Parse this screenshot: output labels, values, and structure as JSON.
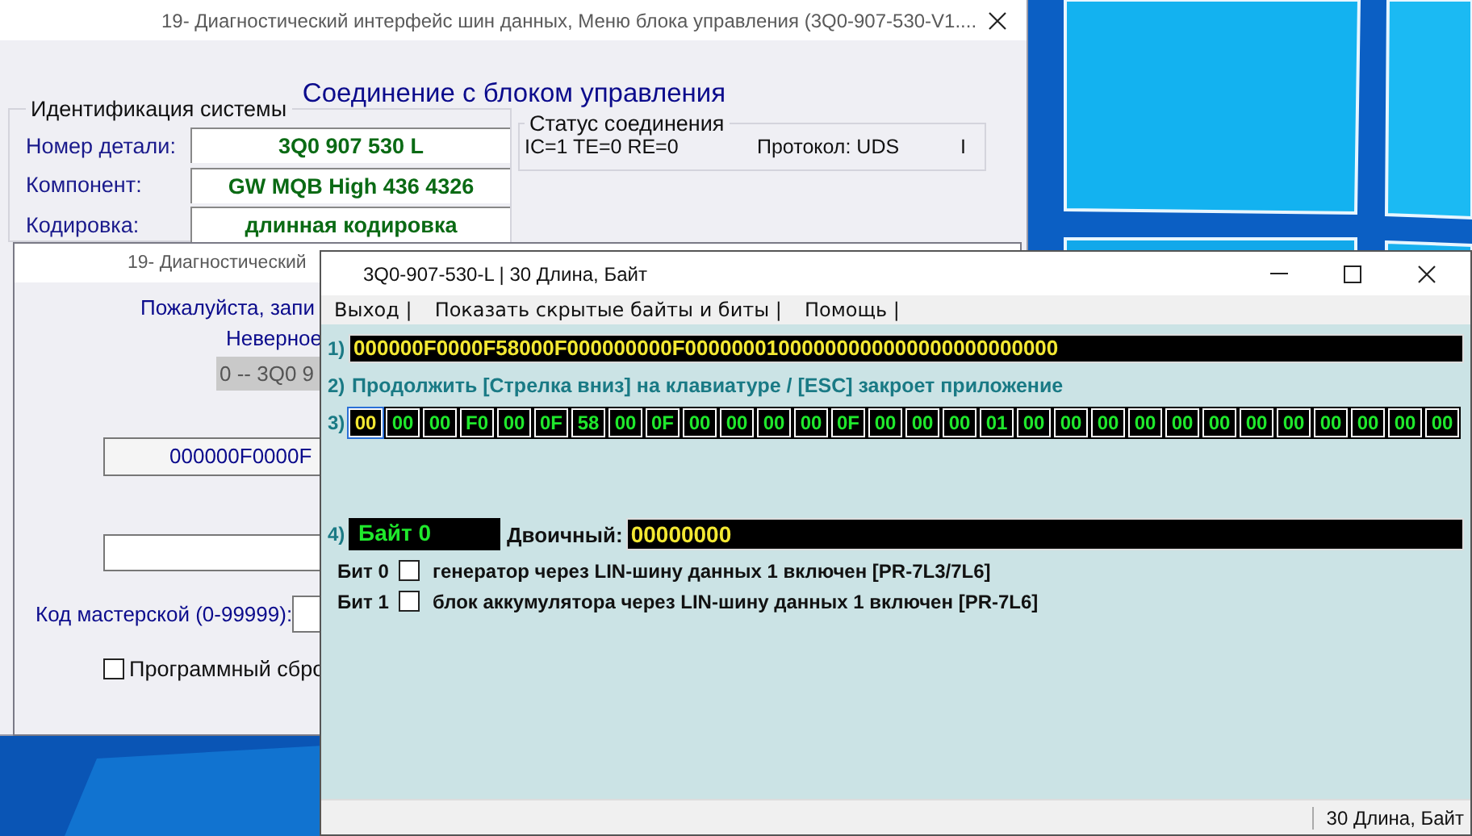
{
  "back_window": {
    "title": "19- Диагностический интерфейс шин данных,  Меню блока управления (3Q0-907-530-V1....",
    "heading": "Соединение с блоком управления",
    "identification": {
      "legend": "Идентификация системы",
      "fields": [
        {
          "label": "Номер детали:",
          "value": "3Q0 907 530 L"
        },
        {
          "label": "Компонент:",
          "value": "GW MQB High   436 4326"
        },
        {
          "label": "Кодировка:",
          "value": "длинная кодировка"
        }
      ]
    },
    "status": {
      "legend": "Статус соединения",
      "counters": "IC=1 TE=0  RE=0",
      "protocol": "Протокол: UDS",
      "indicator": "I"
    }
  },
  "middle_window": {
    "title": "19- Диагностический",
    "prompt": "Пожалуйста, запи",
    "warning": "Неверное",
    "combo_value": "0 -- 3Q0 9",
    "coding_value": "000000F0000F",
    "workshop_label": "Код мастерской (0-99999):",
    "reset": {
      "label": "Программный сбро",
      "checked": false
    }
  },
  "front_window": {
    "title": "3Q0-907-530-L | 30 Длина, Байт",
    "menu": [
      "Выход |",
      "Показать скрытые байты и биты |",
      "Помощь |"
    ],
    "raw_label": "1)",
    "raw_value": "000000F0000F58000F000000000F00000001000000000000000000000000",
    "hint_label": "2)",
    "hint": "Продолжить [Стрелка вниз] на клавиатуре / [ESC] закроет приложение",
    "bytes_label": "3)",
    "bytes": [
      {
        "value": "00",
        "selected": true
      },
      {
        "value": "00",
        "selected": false
      },
      {
        "value": "00",
        "selected": false
      },
      {
        "value": "F0",
        "selected": false
      },
      {
        "value": "00",
        "selected": false
      },
      {
        "value": "0F",
        "selected": false
      },
      {
        "value": "58",
        "selected": false
      },
      {
        "value": "00",
        "selected": false
      },
      {
        "value": "0F",
        "selected": false
      },
      {
        "value": "00",
        "selected": false
      },
      {
        "value": "00",
        "selected": false
      },
      {
        "value": "00",
        "selected": false
      },
      {
        "value": "00",
        "selected": false
      },
      {
        "value": "0F",
        "selected": false
      },
      {
        "value": "00",
        "selected": false
      },
      {
        "value": "00",
        "selected": false
      },
      {
        "value": "00",
        "selected": false
      },
      {
        "value": "01",
        "selected": false
      },
      {
        "value": "00",
        "selected": false
      },
      {
        "value": "00",
        "selected": false
      },
      {
        "value": "00",
        "selected": false
      },
      {
        "value": "00",
        "selected": false
      },
      {
        "value": "00",
        "selected": false
      },
      {
        "value": "00",
        "selected": false
      },
      {
        "value": "00",
        "selected": false
      },
      {
        "value": "00",
        "selected": false
      },
      {
        "value": "00",
        "selected": false
      },
      {
        "value": "00",
        "selected": false
      },
      {
        "value": "00",
        "selected": false
      },
      {
        "value": "00",
        "selected": false
      }
    ],
    "byte_label": "4)",
    "byte_name": "Байт 0",
    "binary_label": "Двоичный:",
    "binary_value": "00000000",
    "bits": [
      {
        "label": "Бит 0",
        "checked": false,
        "description": "генератор через LIN-шину данных 1 включен [PR-7L3/7L6]"
      },
      {
        "label": "Бит 1",
        "checked": false,
        "description": "блок аккумулятора через LIN-шину данных 1 включен [PR-7L6]"
      }
    ],
    "status_bar": "30 Длина, Байт"
  }
}
